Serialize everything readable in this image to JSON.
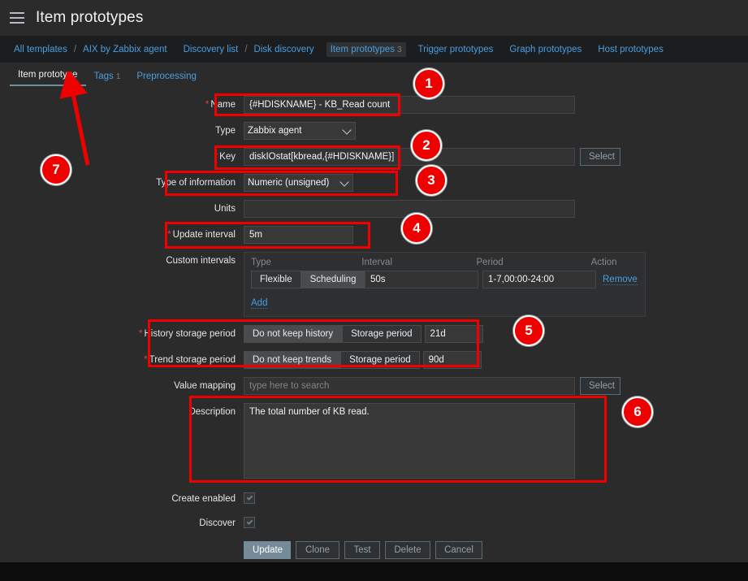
{
  "header": {
    "menu_icon": "hamburger-icon",
    "title": "Item prototypes"
  },
  "breadcrumb": {
    "items": [
      {
        "label": "All templates",
        "selected": false,
        "count": ""
      },
      {
        "label": "AIX by Zabbix agent",
        "selected": false,
        "count": ""
      },
      {
        "label": "Discovery list",
        "selected": false,
        "count": ""
      },
      {
        "label": "Disk discovery",
        "selected": false,
        "count": ""
      },
      {
        "label": "Item prototypes",
        "selected": true,
        "count": "3"
      },
      {
        "label": "Trigger prototypes",
        "selected": false,
        "count": ""
      },
      {
        "label": "Graph prototypes",
        "selected": false,
        "count": ""
      },
      {
        "label": "Host prototypes",
        "selected": false,
        "count": ""
      }
    ],
    "separator": "/"
  },
  "tabs": [
    {
      "label": "Item prototype",
      "active": true,
      "count": ""
    },
    {
      "label": "Tags",
      "active": false,
      "count": "1"
    },
    {
      "label": "Preprocessing",
      "active": false,
      "count": ""
    }
  ],
  "form": {
    "name": {
      "label": "Name",
      "required": true,
      "value": "{#HDISKNAME} - KB_Read count"
    },
    "type": {
      "label": "Type",
      "required": false,
      "value": "Zabbix agent",
      "options": [
        "Zabbix agent"
      ]
    },
    "key": {
      "label": "Key",
      "required": true,
      "value": "diskIOstat[kbread,{#HDISKNAME}]",
      "select_button": "Select"
    },
    "type_of_information": {
      "label": "Type of information",
      "required": false,
      "value": "Numeric (unsigned)",
      "options": [
        "Numeric (unsigned)"
      ]
    },
    "units": {
      "label": "Units",
      "required": false,
      "value": ""
    },
    "update_interval": {
      "label": "Update interval",
      "required": true,
      "value": "5m"
    },
    "custom_intervals": {
      "label": "Custom intervals",
      "columns": [
        "Type",
        "Interval",
        "Period",
        "Action"
      ],
      "rows": [
        {
          "type_options": [
            "Flexible",
            "Scheduling"
          ],
          "type_selected": "Flexible",
          "interval": "50s",
          "period": "1-7,00:00-24:00",
          "action": "Remove"
        }
      ],
      "add_label": "Add"
    },
    "history_storage_period": {
      "label": "History storage period",
      "required": true,
      "options": [
        "Do not keep history",
        "Storage period"
      ],
      "selected": "Storage period",
      "value": "21d"
    },
    "trend_storage_period": {
      "label": "Trend storage period",
      "required": true,
      "options": [
        "Do not keep trends",
        "Storage period"
      ],
      "selected": "Storage period",
      "value": "90d"
    },
    "value_mapping": {
      "label": "Value mapping",
      "value": "",
      "placeholder": "type here to search",
      "select_button": "Select"
    },
    "description": {
      "label": "Description",
      "value": "The total number of KB read."
    },
    "create_enabled": {
      "label": "Create enabled",
      "checked": true
    },
    "discover": {
      "label": "Discover",
      "checked": true
    }
  },
  "actions": {
    "update": "Update",
    "clone": "Clone",
    "test": "Test",
    "delete": "Delete",
    "cancel": "Cancel"
  },
  "annotations": {
    "accent_color": "#ee0000",
    "markers": [
      {
        "number": "1"
      },
      {
        "number": "2"
      },
      {
        "number": "3"
      },
      {
        "number": "4"
      },
      {
        "number": "5"
      },
      {
        "number": "6"
      },
      {
        "number": "7"
      }
    ]
  }
}
